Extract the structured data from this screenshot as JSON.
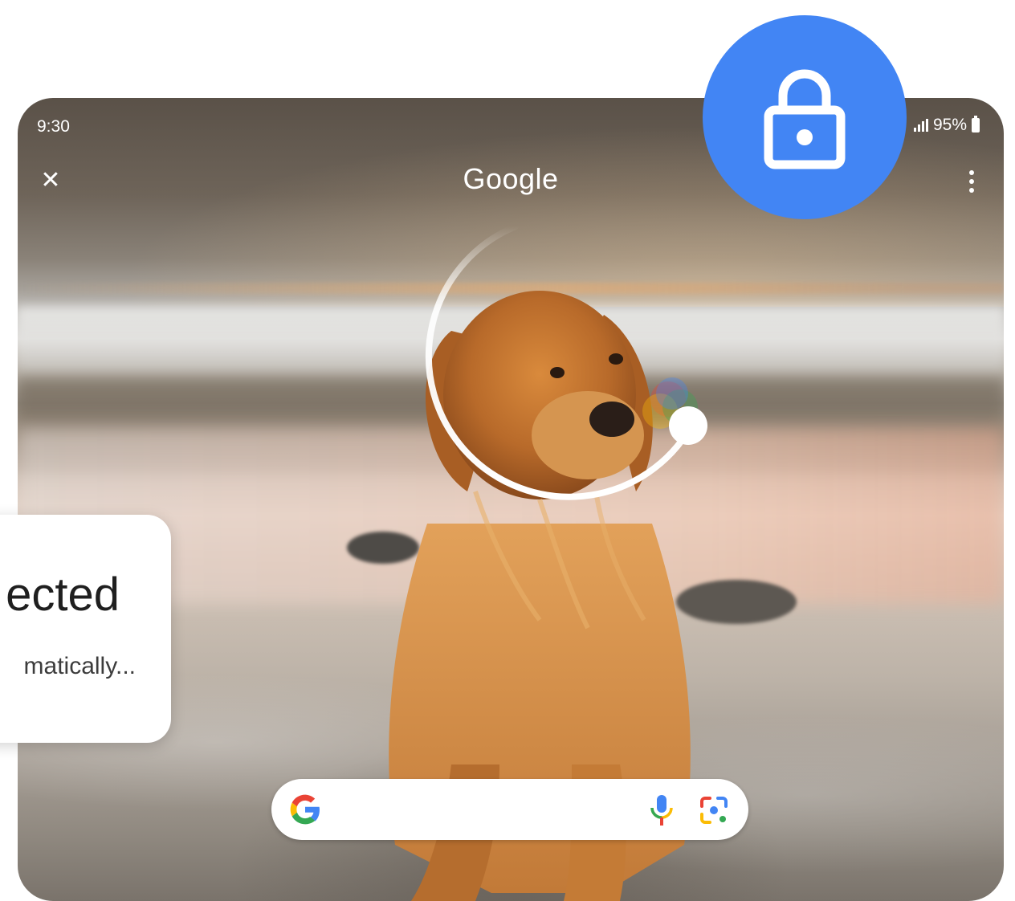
{
  "status_bar": {
    "time": "9:30",
    "battery": "95%"
  },
  "header": {
    "title": "Google",
    "close_icon": "close-icon",
    "more_icon": "more-vert-icon"
  },
  "search_bar": {
    "logo": "google-g-icon",
    "mic_icon": "mic-icon",
    "lens_icon": "google-lens-icon"
  },
  "lock_badge": {
    "icon": "lock-icon",
    "color": "#4285f4"
  },
  "toast": {
    "title": "ected",
    "body": "matically..."
  },
  "colors": {
    "google_blue": "#4285f4",
    "google_red": "#ea4335",
    "google_yellow": "#fbbc05",
    "google_green": "#34a853"
  }
}
